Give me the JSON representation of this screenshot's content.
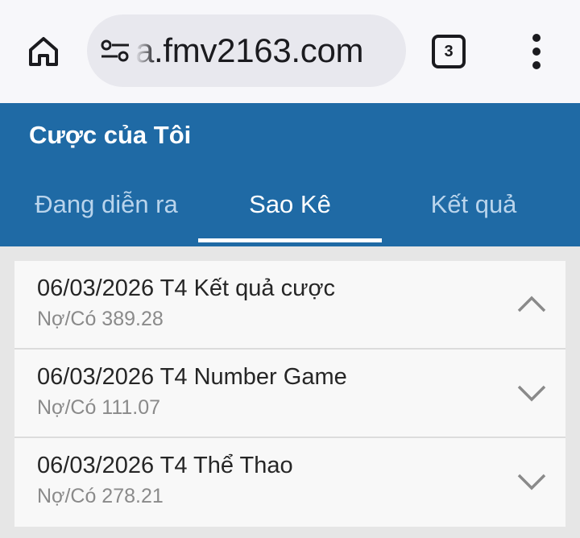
{
  "browser": {
    "url": "a.fmv2163.com",
    "tab_count": "3",
    "icons": {
      "home": "home-icon",
      "site_settings": "tune-icon",
      "tabs": "tab-switcher-icon",
      "menu": "more-vert-icon"
    }
  },
  "header": {
    "title": "Cược của Tôi",
    "tabs": [
      {
        "label": "Đang diễn ra",
        "active": false
      },
      {
        "label": "Sao Kê",
        "active": true
      },
      {
        "label": "Kết quả",
        "active": false
      }
    ]
  },
  "statements": [
    {
      "title": "06/03/2026 T4 Kết quả cược",
      "subtitle": "Nợ/Có 389.28",
      "expanded": true
    },
    {
      "title": "06/03/2026 T4 Number Game",
      "subtitle": "Nợ/Có 111.07",
      "expanded": false
    },
    {
      "title": "06/03/2026 T4 Thể Thao",
      "subtitle": "Nợ/Có 278.21",
      "expanded": false
    }
  ],
  "colors": {
    "header_bg": "#1f6aa5",
    "tab_inactive": "#b9d4ec",
    "tab_active": "#ffffff"
  }
}
